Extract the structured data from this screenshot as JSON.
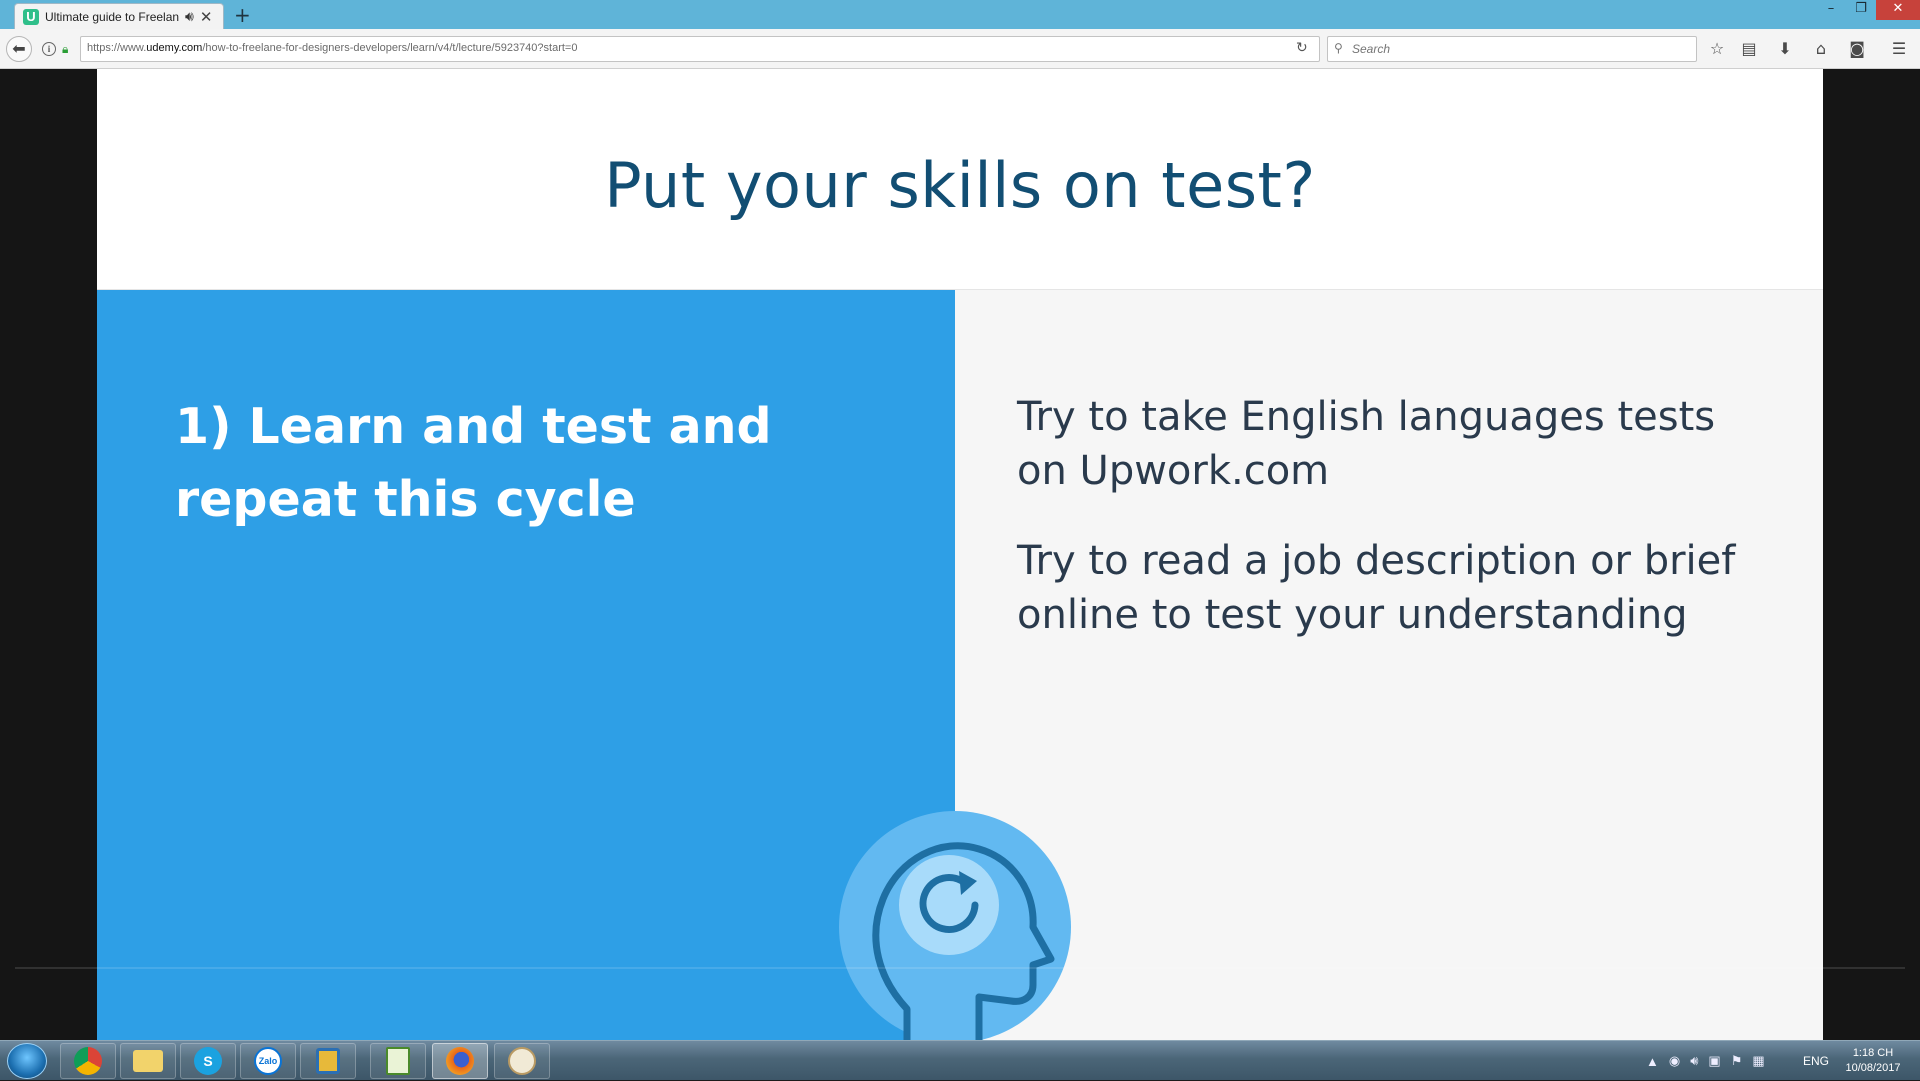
{
  "browser": {
    "tab_title": "Ultimate guide to Freelan",
    "favicon_letter": "U",
    "speaker_icon": "speaker-icon",
    "new_tab": "+",
    "window_controls": {
      "minimize": "–",
      "maximize": "❐",
      "close": "✕"
    },
    "url_prefix": "https://www.",
    "url_domain": "udemy.com",
    "url_path": "/how-to-freelane-for-designers-developers/learn/v4/t/lecture/5923740?start=0",
    "search_placeholder": "Search",
    "toolbar_icons": [
      "bookmark-star-icon",
      "reader-view-icon",
      "download-icon",
      "home-icon",
      "pocket-icon",
      "menu-icon"
    ]
  },
  "slide": {
    "title": "Put your skills on test?",
    "left_heading": "1) Learn and test and repeat this cycle",
    "right_points": [
      "Try to take English languages tests on Upwork.com",
      "Try to read a job description or brief online to test your understanding"
    ],
    "colors": {
      "title": "#124e73",
      "left_panel": "#2e9fe6",
      "head_circle": "#62b9f1",
      "head_outline": "#1e6fa3"
    }
  },
  "taskbar": {
    "apps": [
      {
        "name": "chrome",
        "glyph": ""
      },
      {
        "name": "file-explorer",
        "glyph": ""
      },
      {
        "name": "skype",
        "glyph": "S"
      },
      {
        "name": "zalo",
        "glyph": "Zalo"
      },
      {
        "name": "windows-explorer",
        "glyph": ""
      },
      {
        "name": "sheet-app",
        "glyph": ""
      },
      {
        "name": "firefox",
        "glyph": ""
      },
      {
        "name": "paint",
        "glyph": ""
      }
    ],
    "language": "ENG",
    "time": "1:18 CH",
    "date": "10/08/2017"
  }
}
